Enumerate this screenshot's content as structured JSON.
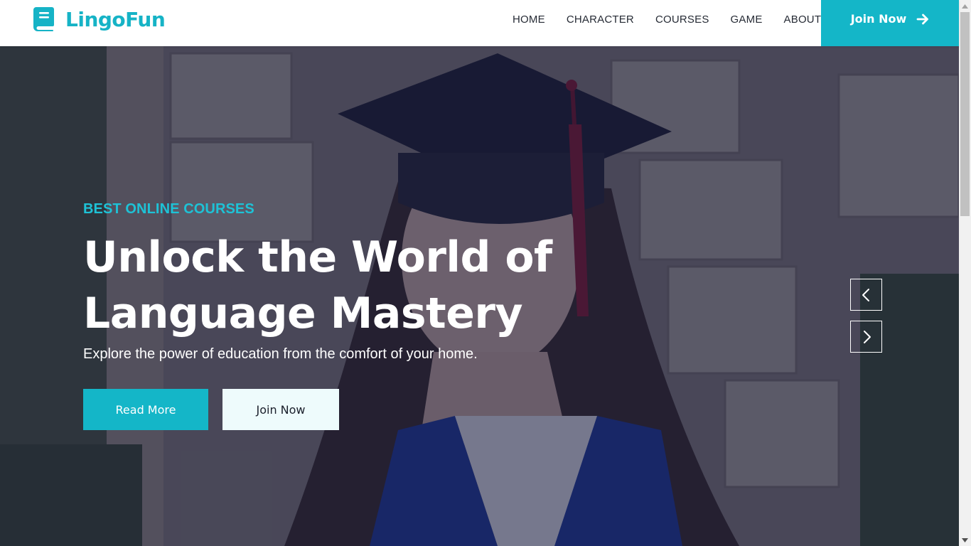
{
  "brand": {
    "name": "LingoFun",
    "icon": "book-icon",
    "color": "#16b3c6"
  },
  "nav": {
    "items": [
      {
        "label": "HOME"
      },
      {
        "label": "CHARACTER"
      },
      {
        "label": "COURSES"
      },
      {
        "label": "GAME"
      },
      {
        "label": "ABOUT"
      }
    ],
    "join_label": "Join Now",
    "join_icon": "arrow-right-icon"
  },
  "hero": {
    "eyebrow": "BEST ONLINE COURSES",
    "headline_line1": "Unlock the World of",
    "headline_line2": "Language Mastery",
    "subline": "Explore the power of education from the comfort of your home.",
    "read_more_label": "Read More",
    "join_label": "Join Now",
    "prev_icon": "chevron-left-icon",
    "next_icon": "chevron-right-icon"
  },
  "colors": {
    "accent": "#14b6c8",
    "nav_text": "#262b35",
    "light_button": "#eefbfc"
  }
}
